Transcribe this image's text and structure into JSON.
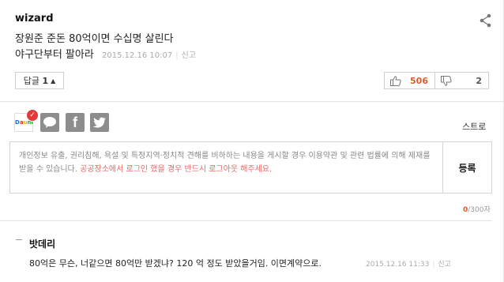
{
  "comment": {
    "author": "wizard",
    "line1": "장원준 준돈 80억이면 수십명 살린다",
    "line2": "야구단부터 팔아라",
    "timestamp": "2015.12.16 10:07",
    "report": "신고",
    "reply_button": "답글",
    "reply_count": "1",
    "upvotes": "506",
    "downvotes": "2"
  },
  "sns": {
    "daum_text": "Daum",
    "stray_label": "스트로"
  },
  "form": {
    "notice_main": "개인정보 유출, 권리침해, 욕설 및 특정지역·정치적 견해를 비하하는 내용을 게시할 경우 이용약관 및 관련 법률에 의해 제재를 받을 수 있습니다.",
    "notice_warn": "공공장소에서 로그인 했을 경우 반드시 로그아웃 해주세요.",
    "submit_label": "등록",
    "counter_current": "0",
    "counter_max": "/300자"
  },
  "reply": {
    "author": "밧데리",
    "text": "80억은 무슨, 너같으면 80억만 받겠냐? 120 억 정도 받았을거임. 이면계약으로.",
    "timestamp": "2015.12.16 11:33",
    "report": "신고"
  },
  "colors": {
    "accent": "#e05a2b",
    "warn": "#e36a6a",
    "sns_gray": "#8d8d8d"
  }
}
